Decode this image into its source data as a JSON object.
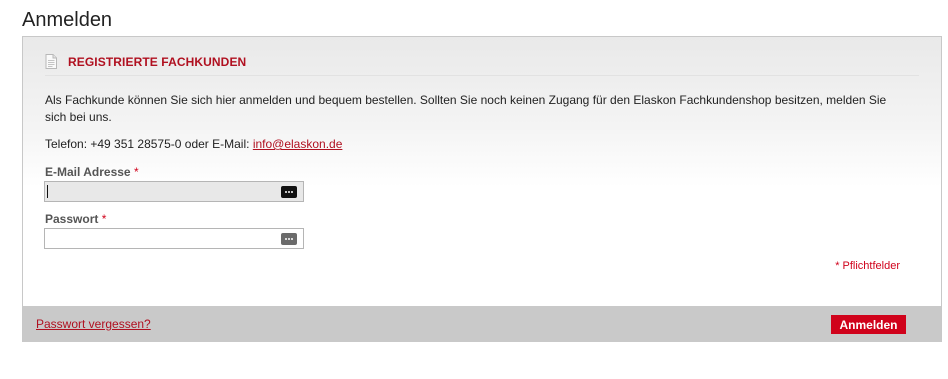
{
  "page": {
    "title": "Anmelden"
  },
  "login_box": {
    "icon": "document-icon",
    "heading": "REGISTRIERTE FACHKUNDEN",
    "intro": "Als Fachkunde können Sie sich hier anmelden und bequem bestellen. Sollten Sie noch keinen Zugang für den Elaskon Fachkundenshop besitzen, melden Sie sich bei uns.",
    "contact_prefix": "Telefon: +49 351 28575-0 oder E-Mail: ",
    "contact_email": "info@elaskon.de",
    "email": {
      "label": "E-Mail Adresse",
      "required_mark": "*",
      "value": "",
      "icon": "password-manager-icon"
    },
    "password": {
      "label": "Passwort",
      "required_mark": "*",
      "value": "",
      "icon": "password-manager-icon"
    },
    "required_note": "* Pflichtfelder"
  },
  "footer": {
    "forgot_label": "Passwort vergessen?",
    "submit_label": "Anmelden"
  },
  "colors": {
    "accent": "#d0021b",
    "heading": "#b01020",
    "footer_bg": "#c9c9c9"
  }
}
